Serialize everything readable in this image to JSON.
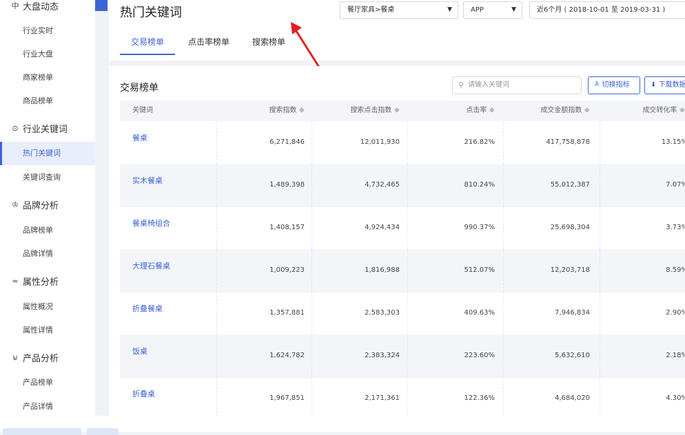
{
  "sidebar": {
    "groups": [
      {
        "label": "大盘动态",
        "icon": "dashboard-icon",
        "items": [
          "行业实时",
          "行业大盘",
          "商家榜单",
          "商品榜单"
        ]
      },
      {
        "label": "行业关键词",
        "icon": "keyword-icon",
        "items": [
          "热门关键词",
          "关键词查询"
        ]
      },
      {
        "label": "品牌分析",
        "icon": "crown-icon",
        "items": [
          "品牌榜单",
          "品牌详情"
        ]
      },
      {
        "label": "属性分析",
        "icon": "attribute-icon",
        "items": [
          "属性概况",
          "属性详情"
        ]
      },
      {
        "label": "产品分析",
        "icon": "product-icon",
        "items": [
          "产品榜单",
          "产品详情"
        ]
      }
    ],
    "active_item": "热门关键词"
  },
  "header": {
    "title": "热门关键词",
    "category_select": "餐厅家具>餐桌",
    "platform_select": "APP",
    "date_range": "近6个月 ( 2018-10-01 至 2019-03-31 )",
    "tabs": [
      "交易榜单",
      "点击率榜单",
      "搜索榜单"
    ],
    "active_tab": "交易榜单"
  },
  "panel": {
    "title": "交易榜单",
    "search_placeholder": "请输入关键词",
    "switch_button": "切换指标",
    "download_button": "下载数据",
    "columns": [
      "关键词",
      "搜索指数 ≑",
      "搜索点击指数 ≑",
      "点击率 ≑",
      "成交金额指数 ≑",
      "成交转化率 ≑"
    ],
    "rows": [
      [
        "餐桌",
        "6,271,846",
        "12,011,930",
        "216.82%",
        "417,758,878",
        "13.15%"
      ],
      [
        "实木餐桌",
        "1,489,398",
        "4,732,465",
        "810.24%",
        "55,012,387",
        "7.07%"
      ],
      [
        "餐桌椅组合",
        "1,408,157",
        "4,924,434",
        "990.37%",
        "25,698,304",
        "3.73%"
      ],
      [
        "大理石餐桌",
        "1,009,223",
        "1,816,988",
        "512.07%",
        "12,203,718",
        "8.59%"
      ],
      [
        "折叠餐桌",
        "1,357,881",
        "2,583,303",
        "409.63%",
        "7,946,834",
        "2.90%"
      ],
      [
        "饭桌",
        "1,624,782",
        "2,383,324",
        "223.60%",
        "5,632,610",
        "2.18%"
      ],
      [
        "折叠桌",
        "1,967,851",
        "2,171,361",
        "122.36%",
        "4,684,020",
        "4.30%"
      ]
    ]
  },
  "colors": {
    "accent": "#3e63d8",
    "arrow": "#e02020",
    "row_alt": "#f3f5f9"
  }
}
